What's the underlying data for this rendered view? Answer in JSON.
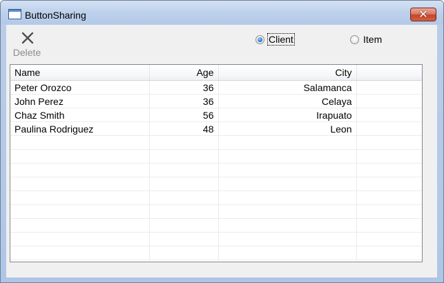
{
  "window": {
    "title": "ButtonSharing",
    "close_glyph": "✕"
  },
  "toolbar": {
    "delete_label": "Delete",
    "delete_icon": "close-x-icon"
  },
  "mode": {
    "selected": "Client",
    "options": [
      {
        "label": "Client",
        "checked": true
      },
      {
        "label": "Item",
        "checked": false
      }
    ]
  },
  "grid": {
    "columns": [
      "Name",
      "Age",
      "City",
      ""
    ],
    "rows": [
      [
        "Peter Orozco",
        "36",
        "Salamanca"
      ],
      [
        "John Perez",
        "36",
        "Celaya"
      ],
      [
        "Chaz Smith",
        "56",
        "Irapuato"
      ],
      [
        "Paulina Rodriguez",
        "48",
        "Leon"
      ]
    ]
  }
}
